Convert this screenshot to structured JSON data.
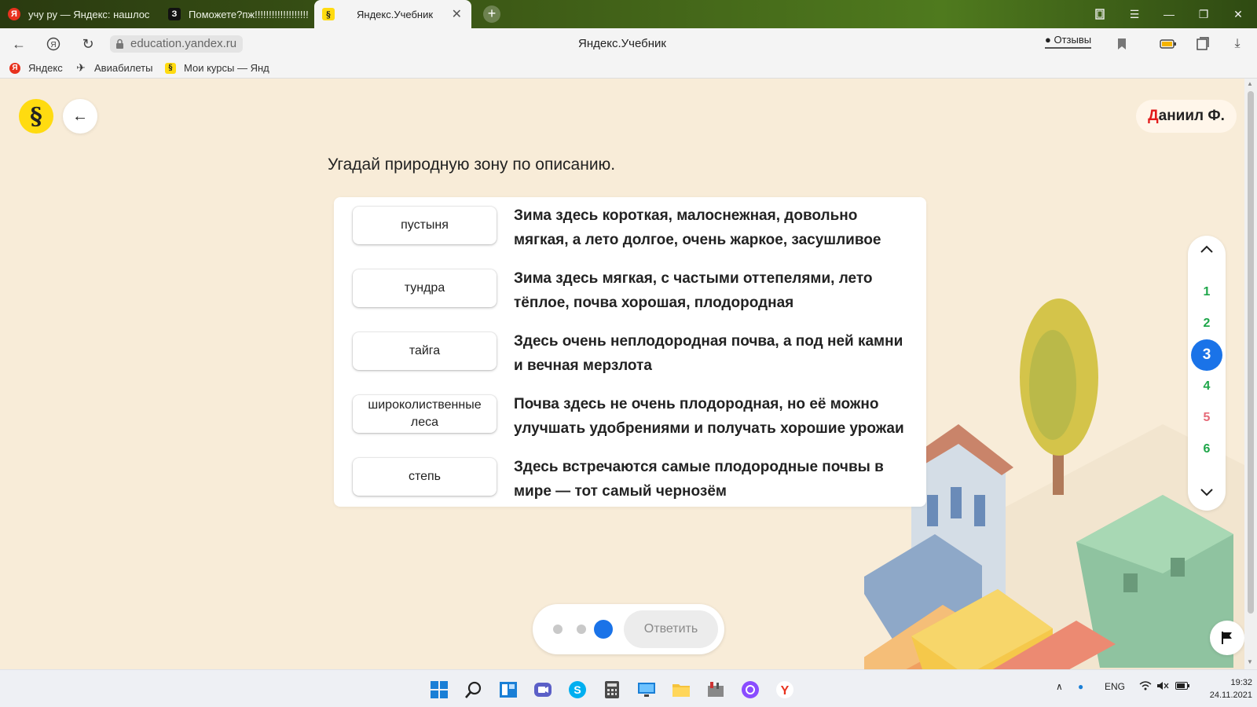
{
  "browser": {
    "tabs": [
      {
        "label": "учу ру — Яндекс: нашлос",
        "icon": "yandex-icon"
      },
      {
        "label": "Поможете?пж!!!!!!!!!!!!!!!!!!!",
        "icon": "znanija-icon"
      },
      {
        "label": "Яндекс.Учебник",
        "icon": "uchebnik-icon",
        "active": true
      }
    ],
    "url": "education.yandex.ru",
    "page_title": "Яндекс.Учебник",
    "reviews_label": "Отзывы",
    "bookmarks": [
      {
        "label": "Яндекс",
        "icon": "yandex-icon"
      },
      {
        "label": "Авиабилеты",
        "icon": "plane-icon"
      },
      {
        "label": "Мои курсы — Янд",
        "icon": "uchebnik-icon"
      }
    ]
  },
  "app": {
    "user_initial": "Д",
    "user_name_rest": "аниил Ф.",
    "question": "Угадай природную зону по описанию.",
    "rows": [
      {
        "chip": "пустыня",
        "description": "Зима здесь короткая, малоснежная, довольно мягкая, а лето долгое, очень жаркое, засушливое"
      },
      {
        "chip": "тундра",
        "description": "Зима здесь мягкая, с частыми оттепелями, лето тёплое, почва хорошая, плодородная"
      },
      {
        "chip": "тайга",
        "description": "Здесь очень неплодородная почва, а под ней камни и вечная мерзлота"
      },
      {
        "chip": "широколиственные леса",
        "description": "Почва здесь не очень плодородная, но её можно улучшать удобрениями и получать хорошие урожаи"
      },
      {
        "chip": "степь",
        "description": "Здесь встречаются самые плодородные почвы в мире — тот самый чернозём"
      }
    ],
    "task_numbers": [
      {
        "label": "1",
        "state": "done"
      },
      {
        "label": "2",
        "state": "done"
      },
      {
        "label": "3",
        "state": "active"
      },
      {
        "label": "4",
        "state": "done"
      },
      {
        "label": "5",
        "state": "wrong"
      },
      {
        "label": "6",
        "state": "done"
      }
    ],
    "answer_label": "Ответить",
    "step_dots": {
      "total": 3,
      "current": 3
    },
    "colors": {
      "accent": "#1a73e8",
      "done": "#1fa64a",
      "wrong": "#e66a78",
      "logo": "#ffdb10",
      "background": "#f8ecd8"
    }
  },
  "taskbar": {
    "language": "ENG",
    "time": "19:32",
    "date": "24.11.2021"
  }
}
